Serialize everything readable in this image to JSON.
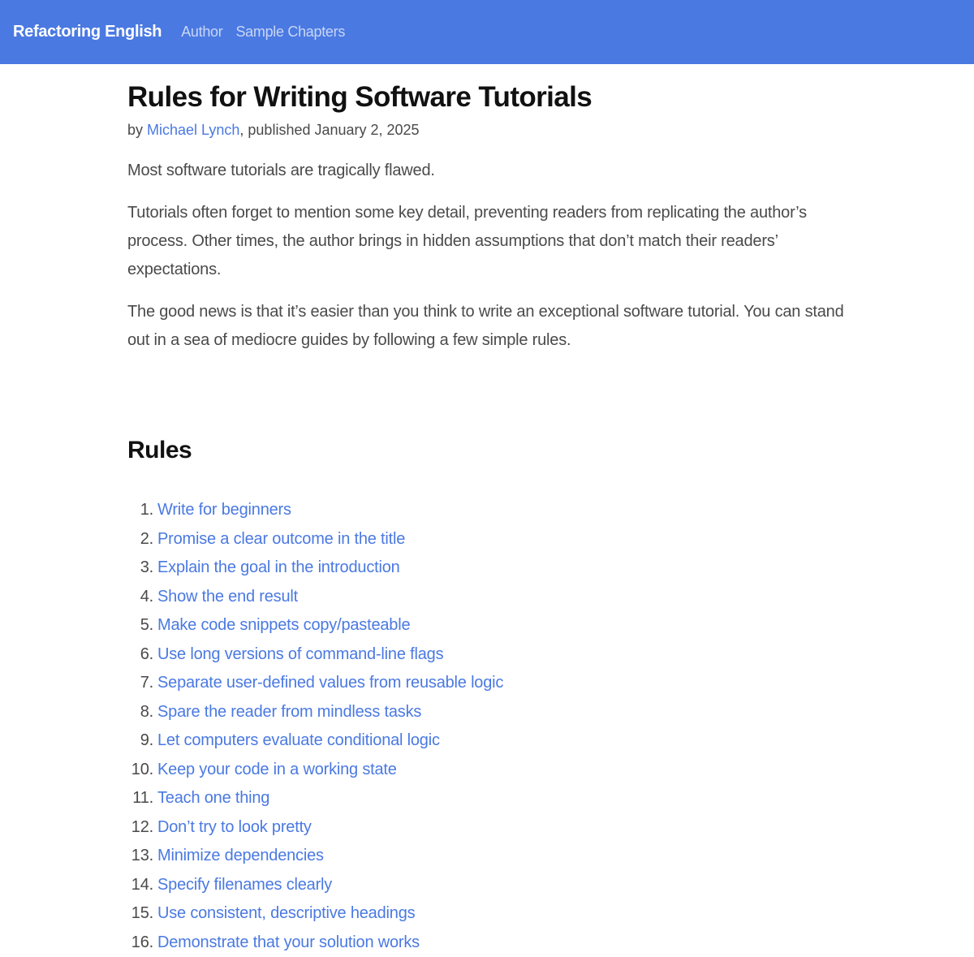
{
  "nav": {
    "brand": "Refactoring English",
    "links": [
      "Author",
      "Sample Chapters"
    ]
  },
  "article": {
    "title": "Rules for Writing Software Tutorials",
    "byline_prefix": "by ",
    "author": "Michael Lynch",
    "byline_suffix": ", published January 2, 2025",
    "paragraphs": [
      "Most software tutorials are tragically flawed.",
      "Tutorials often forget to mention some key detail, preventing readers from replicating the author’s process. Other times, the author brings in hidden assumptions that don’t match their readers’ expectations.",
      "The good news is that it’s easier than you think to write an exceptional software tutorial. You can stand out in a sea of mediocre guides by following a few simple rules."
    ],
    "rules_heading": "Rules",
    "rules": [
      {
        "num": "1.",
        "label": "Write for beginners"
      },
      {
        "num": "2.",
        "label": "Promise a clear outcome in the title"
      },
      {
        "num": "3.",
        "label": "Explain the goal in the introduction"
      },
      {
        "num": "4.",
        "label": "Show the end result"
      },
      {
        "num": "5.",
        "label": "Make code snippets copy/pasteable"
      },
      {
        "num": "6.",
        "label": "Use long versions of command-line flags"
      },
      {
        "num": "7.",
        "label": "Separate user-defined values from reusable logic"
      },
      {
        "num": "8.",
        "label": "Spare the reader from mindless tasks"
      },
      {
        "num": "9.",
        "label": "Let computers evaluate conditional logic"
      },
      {
        "num": "10.",
        "label": "Keep your code in a working state"
      },
      {
        "num": "11.",
        "label": "Teach one thing"
      },
      {
        "num": "12.",
        "label": "Don’t try to look pretty"
      },
      {
        "num": "13.",
        "label": "Minimize dependencies"
      },
      {
        "num": "14.",
        "label": "Specify filenames clearly"
      },
      {
        "num": "15.",
        "label": "Use consistent, descriptive headings"
      },
      {
        "num": "16.",
        "label": "Demonstrate that your solution works"
      }
    ]
  },
  "colors": {
    "navbar": "#4a79e2",
    "link": "#4a79e2",
    "text": "#4a4a4a",
    "heading": "#111111"
  }
}
